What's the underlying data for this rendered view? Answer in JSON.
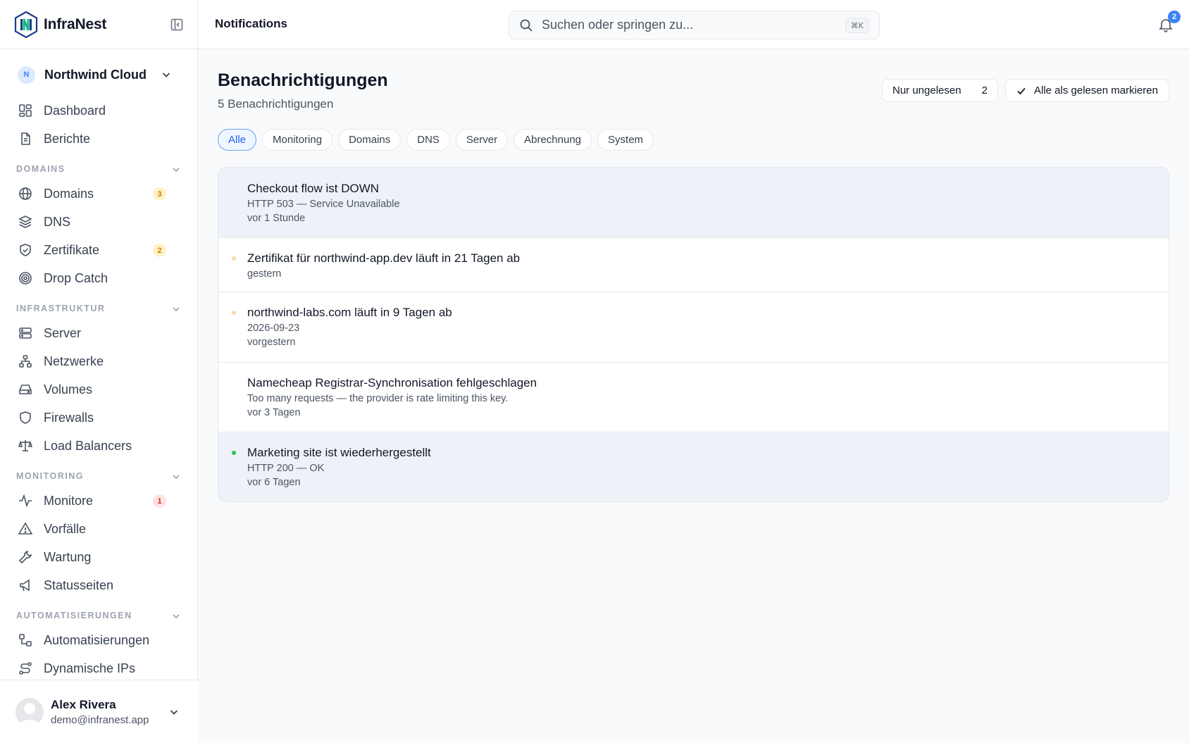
{
  "brand": {
    "name": "InfraNest"
  },
  "workspace": {
    "initial": "N",
    "name": "Northwind Cloud"
  },
  "nav": {
    "top": [
      {
        "label": "Dashboard"
      },
      {
        "label": "Berichte"
      }
    ],
    "sections": [
      {
        "title": "DOMAINS",
        "items": [
          {
            "label": "Domains",
            "badge": "3"
          },
          {
            "label": "DNS"
          },
          {
            "label": "Zertifikate",
            "badge": "2"
          },
          {
            "label": "Drop Catch"
          }
        ]
      },
      {
        "title": "INFRASTRUKTUR",
        "items": [
          {
            "label": "Server"
          },
          {
            "label": "Netzwerke"
          },
          {
            "label": "Volumes"
          },
          {
            "label": "Firewalls"
          },
          {
            "label": "Load Balancers"
          }
        ]
      },
      {
        "title": "MONITORING",
        "items": [
          {
            "label": "Monitore",
            "badge": "1"
          },
          {
            "label": "Vorfälle"
          },
          {
            "label": "Wartung"
          },
          {
            "label": "Statusseiten"
          }
        ]
      },
      {
        "title": "AUTOMATISIERUNGEN",
        "items": [
          {
            "label": "Automatisierungen"
          },
          {
            "label": "Dynamische IPs"
          }
        ]
      }
    ]
  },
  "user": {
    "name": "Alex Rivera",
    "email": "demo@infranest.app"
  },
  "topbar": {
    "title": "Notifications",
    "search_placeholder": "Suchen oder springen zu...",
    "shortcut": "⌘K",
    "bell_count": "2"
  },
  "page": {
    "title": "Benachrichtigungen",
    "subtitle": "5 Benachrichtigungen",
    "unread_label": "Nur ungelesen",
    "unread_count": "2",
    "mark_all_label": "Alle als gelesen markieren"
  },
  "filters": [
    "Alle",
    "Monitoring",
    "Domains",
    "DNS",
    "Server",
    "Abrechnung",
    "System"
  ],
  "notifications": [
    {
      "title": "Checkout flow ist DOWN",
      "detail": "HTTP 503 — Service Unavailable",
      "time": "vor 1 Stunde"
    },
    {
      "title": "Zertifikat für northwind-app.dev läuft in 21 Tagen ab",
      "time": "gestern"
    },
    {
      "title": "northwind-labs.com läuft in 9 Tagen ab",
      "detail": "2026-09-23",
      "time": "vorgestern"
    },
    {
      "title": "Namecheap Registrar-Synchronisation fehlgeschlagen",
      "detail": "Too many requests — the provider is rate limiting this key.",
      "time": "vor 3 Tagen"
    },
    {
      "title": "Marketing site ist wiederhergestellt",
      "detail": "HTTP 200 — OK",
      "time": "vor 6 Tagen"
    }
  ],
  "colors": {
    "accent": "#3b82f6",
    "warning_dot": "#fcd9a8",
    "success_dot": "#22c55e",
    "row_tint": "#eef2f8"
  }
}
